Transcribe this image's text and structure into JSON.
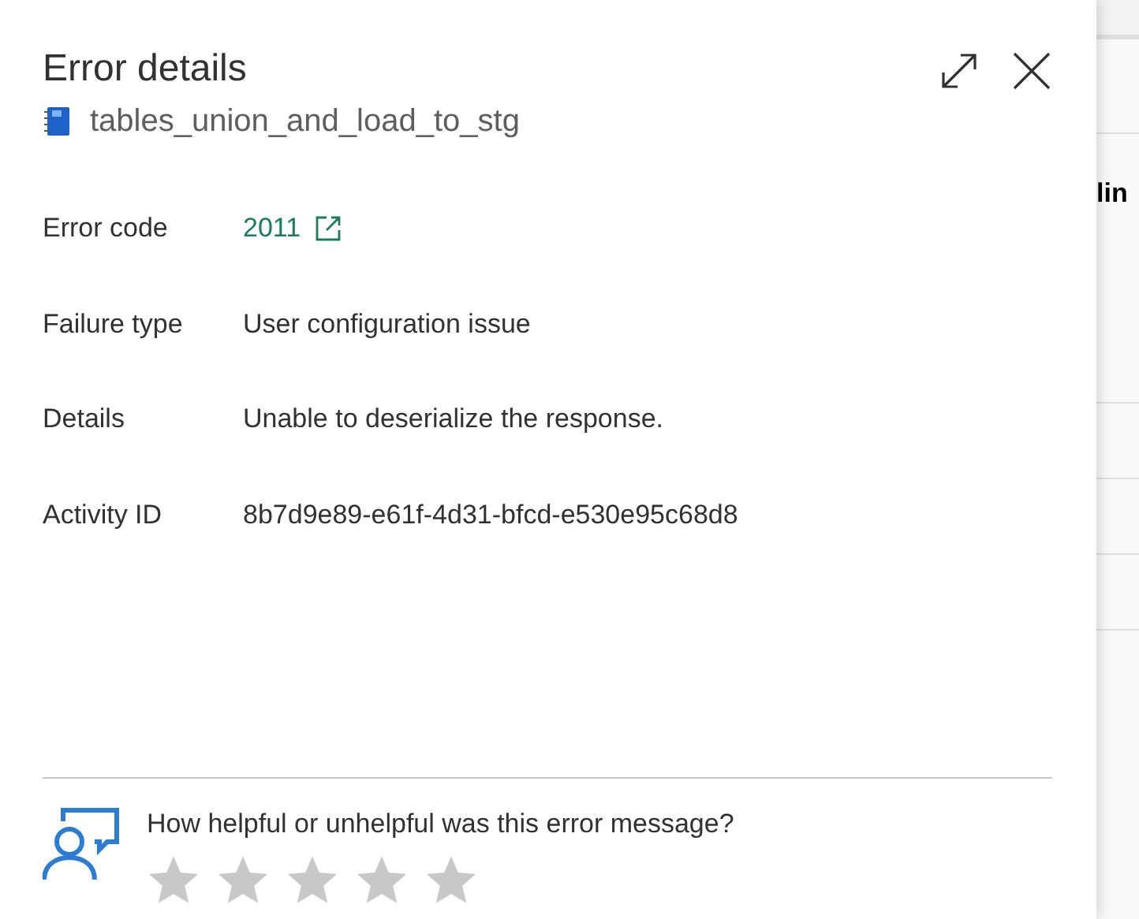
{
  "panel": {
    "title": "Error details",
    "pipeline_name": "tables_union_and_load_to_stg",
    "fields": [
      {
        "label": "Error code",
        "value": "2011",
        "kind": "link"
      },
      {
        "label": "Failure type",
        "value": "User configuration issue",
        "kind": "text"
      },
      {
        "label": "Details",
        "value": "Unable to deserialize the response.",
        "kind": "text"
      },
      {
        "label": "Activity ID",
        "value": "8b7d9e89-e61f-4d31-bfcd-e530e95c68d8",
        "kind": "text"
      }
    ],
    "feedback": {
      "question": "How helpful or unhelpful was this error message?",
      "stars": 0
    }
  },
  "background": {
    "heading": "lin"
  }
}
